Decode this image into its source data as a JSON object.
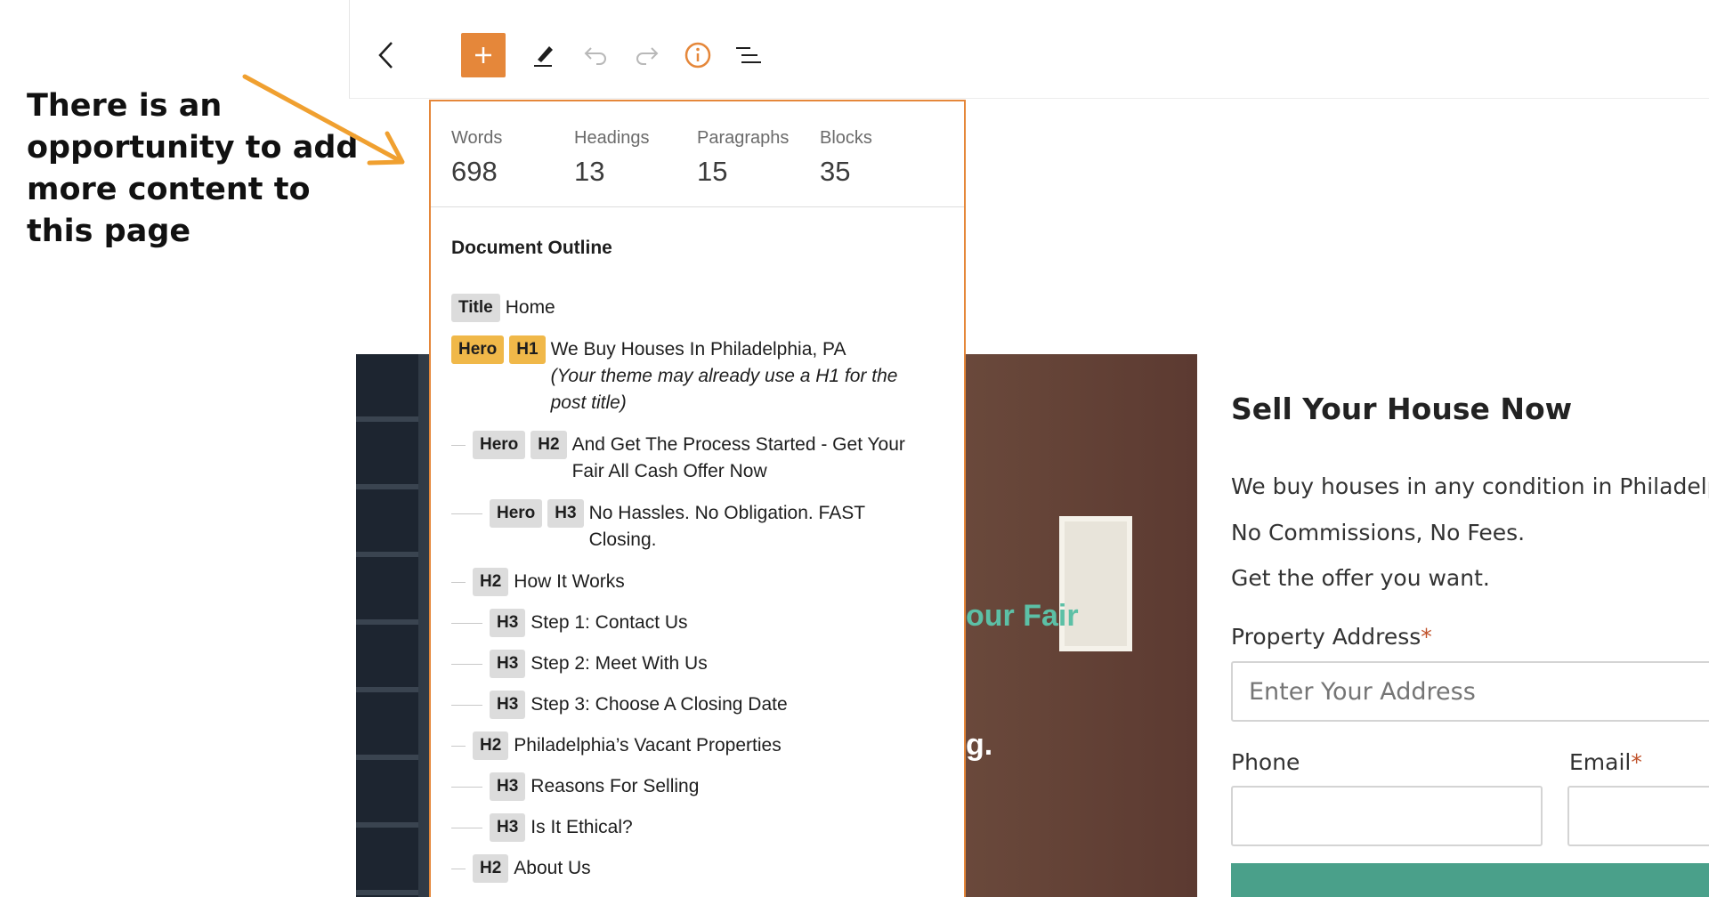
{
  "annotation": {
    "text": "There is an opportunity to add more content to this page"
  },
  "toolbar": {
    "back_label": "Back",
    "add_label": "+",
    "buttons": [
      "back-icon",
      "plus-icon",
      "pencil-icon",
      "undo-icon",
      "redo-icon",
      "info-icon",
      "list-view-icon"
    ],
    "colors": {
      "accent": "#e5873a"
    }
  },
  "stats": [
    {
      "label": "Words",
      "value": "698"
    },
    {
      "label": "Headings",
      "value": "13"
    },
    {
      "label": "Paragraphs",
      "value": "15"
    },
    {
      "label": "Blocks",
      "value": "35"
    }
  ],
  "outline": {
    "title": "Document Outline",
    "items": [
      {
        "level": 0,
        "badges": [
          "Title"
        ],
        "text": "Home"
      },
      {
        "level": 0,
        "badges": [
          "Hero",
          "H1"
        ],
        "warn": true,
        "text": "We Buy Houses In Philadelphia, PA",
        "note": "(Your theme may already use a H1 for the post title)"
      },
      {
        "level": 1,
        "badges": [
          "Hero",
          "H2"
        ],
        "text": "And Get The Process Started - Get Your Fair All Cash Offer Now"
      },
      {
        "level": 2,
        "badges": [
          "Hero",
          "H3"
        ],
        "text": "No Hassles. No Obligation. FAST Closing."
      },
      {
        "level": 1,
        "badges": [
          "H2"
        ],
        "text": "How It Works"
      },
      {
        "level": 2,
        "badges": [
          "H3"
        ],
        "text": "Step 1: Contact Us"
      },
      {
        "level": 2,
        "badges": [
          "H3"
        ],
        "text": "Step 2: Meet With Us"
      },
      {
        "level": 2,
        "badges": [
          "H3"
        ],
        "text": "Step 3: Choose A Closing Date"
      },
      {
        "level": 1,
        "badges": [
          "H2"
        ],
        "text": "Philadelphia’s Vacant Properties"
      },
      {
        "level": 2,
        "badges": [
          "H3"
        ],
        "text": "Reasons For Selling"
      },
      {
        "level": 2,
        "badges": [
          "H3"
        ],
        "text": "Is It Ethical?"
      },
      {
        "level": 1,
        "badges": [
          "H2"
        ],
        "text": "About Us"
      }
    ]
  },
  "hero": {
    "partial_text_1": "our Fair",
    "partial_text_2": "g."
  },
  "form": {
    "title": "Sell Your House Now",
    "lines": [
      "We buy houses in any condition in Philadelph",
      "No Commissions, No Fees.",
      "Get the offer you want."
    ],
    "address_label": "Property Address",
    "address_placeholder": "Enter Your Address",
    "phone_label": "Phone",
    "email_label": "Email",
    "required_mark": "*"
  }
}
